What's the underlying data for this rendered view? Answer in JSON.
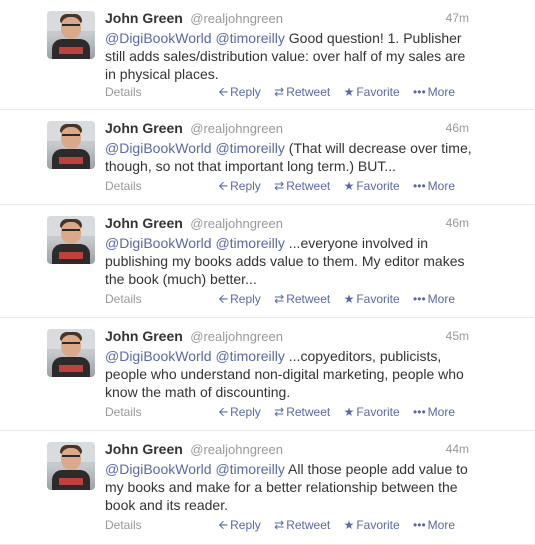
{
  "tweets": [
    {
      "name": "John Green",
      "handle": "@realjohngreen",
      "time": "47m",
      "mention1": "@DigiBookWorld",
      "mention2": "@timoreilly",
      "text": " Good question! 1. Publisher still adds sales/distribution value: over half of my sales are in physical places."
    },
    {
      "name": "John Green",
      "handle": "@realjohngreen",
      "time": "46m",
      "mention1": "@DigiBookWorld",
      "mention2": "@timoreilly",
      "text": " (That will decrease over time, though, so not that important long term.) BUT..."
    },
    {
      "name": "John Green",
      "handle": "@realjohngreen",
      "time": "46m",
      "mention1": "@DigiBookWorld",
      "mention2": "@timoreilly",
      "text": " ...everyone involved in publishing my books adds value to them. My editor makes the book (much) better..."
    },
    {
      "name": "John Green",
      "handle": "@realjohngreen",
      "time": "45m",
      "mention1": "@DigiBookWorld",
      "mention2": "@timoreilly",
      "text": " ...copyeditors, publicists, people who understand non-digital marketing, people who know the math of discounting."
    },
    {
      "name": "John Green",
      "handle": "@realjohngreen",
      "time": "44m",
      "mention1": "@DigiBookWorld",
      "mention2": "@timoreilly",
      "text": " All those people add value to my books and make for a better relationship between the book and its reader."
    }
  ],
  "actions": {
    "details": "Details",
    "reply": "Reply",
    "retweet": "Retweet",
    "favorite": "Favorite",
    "more": "More",
    "reply_icon": "reply-arrow-icon",
    "retweet_icon": "retweet-icon",
    "favorite_icon": "star-icon",
    "more_icon": "dots-icon"
  },
  "colors": {
    "link": "#5b68a9",
    "muted": "#999999",
    "text": "#333333",
    "divider": "#e8e8e8"
  }
}
